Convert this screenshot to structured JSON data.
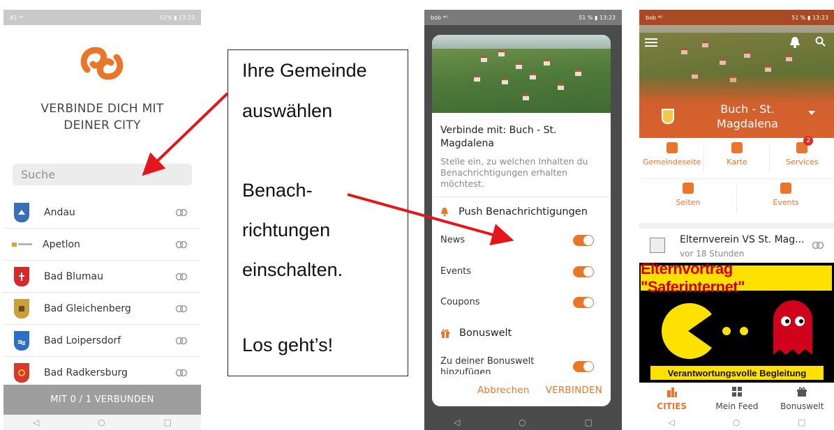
{
  "phone1": {
    "status_left": "A1 ⁴ᴳ",
    "status_right": "51% ▮ 13:23",
    "heading_line1": "VERBINDE DICH MIT",
    "heading_line2": "DEINER CITY",
    "search_placeholder": "Suche",
    "cities": [
      {
        "name": "Andau",
        "crest_color": "#3a6fb6"
      },
      {
        "name": "Apetlon",
        "crest_color": "#d9a441"
      },
      {
        "name": "Bad Blumau",
        "crest_color": "#d42a2a"
      },
      {
        "name": "Bad Gleichenberg",
        "crest_color": "#c9a13b"
      },
      {
        "name": "Bad Loipersdorf",
        "crest_color": "#2d6fc4"
      },
      {
        "name": "Bad Radkersburg",
        "crest_color": "#d63a2a"
      }
    ],
    "bottom_button": "MIT 0 / 1 VERBUNDEN"
  },
  "instructions": {
    "line1": "Ihre Gemeinde",
    "line2": "auswählen",
    "line3": "Benach-",
    "line4": "richtungen",
    "line5": "einschalten.",
    "line6": "Los geht’s!"
  },
  "phone2": {
    "status_left": "bob ⁴ᴳ",
    "status_right": "51 % ▮ 13:23",
    "title": "Verbinde mit: Buch - St. Magdalena",
    "description": "Stelle ein, zu welchen Inhalten du Benachrichtigungen erhalten möchtest.",
    "push_section": "Push Benachrichtigungen",
    "toggles": [
      "News",
      "Events",
      "Coupons"
    ],
    "bonus_section": "Bonuswelt",
    "bonus_toggle": "Zu deiner Bonuswelt hinzufügen",
    "cancel": "Abbrechen",
    "connect": "VERBINDEN"
  },
  "phone3": {
    "status_left": "bob ⁴ᴳ",
    "status_right": "51 % ▮ 13:23",
    "city_name": "Buch - St. Magdalena",
    "grid_row1": [
      "Gemeindeseite",
      "Karte",
      "Services"
    ],
    "services_badge": "2",
    "grid_row2": [
      "Seiten",
      "Events"
    ],
    "post_author": "Elternverein VS St. Mag...",
    "post_time": "vor 18 Stunden",
    "banner_title": "Elternvortrag \"Saferinternet\"",
    "banner_subtitle": "Verantwortungsvolle Begleitung",
    "tabs": [
      "CITIES",
      "Mein Feed",
      "Bonuswelt"
    ]
  },
  "colors": {
    "accent": "#e9762b",
    "arrow": "#e4161b"
  }
}
